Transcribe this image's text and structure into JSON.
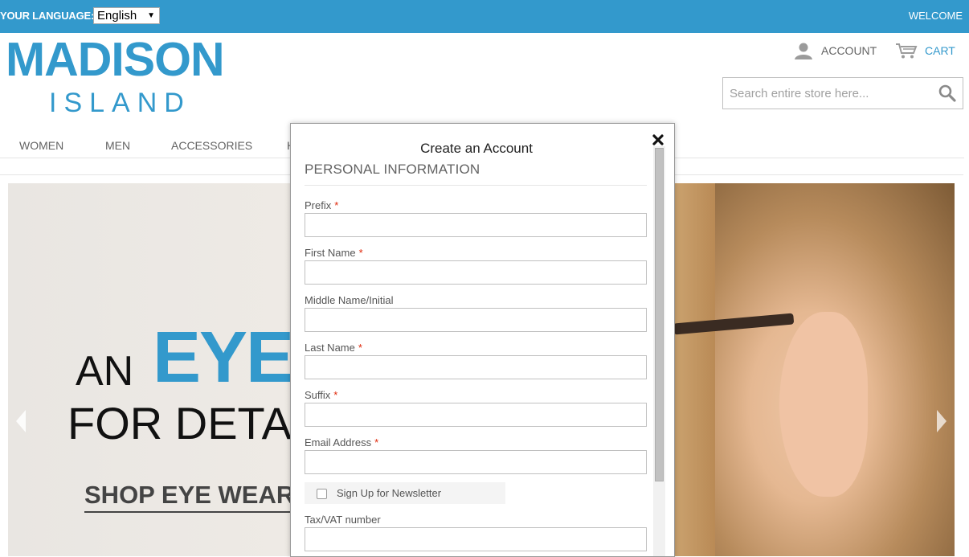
{
  "topbar": {
    "language_label": "YOUR LANGUAGE:",
    "language_selected": "English",
    "welcome": "WELCOME",
    "bg_color": "#3399cc"
  },
  "logo": {
    "main": "MADISON",
    "sub": "ISLAND"
  },
  "header": {
    "account_label": "ACCOUNT",
    "cart_label": "CART",
    "search_placeholder": "Search entire store here..."
  },
  "nav": {
    "items": [
      {
        "label": "WOMEN"
      },
      {
        "label": "MEN"
      },
      {
        "label": "ACCESSORIES"
      },
      {
        "label": "H"
      }
    ]
  },
  "hero": {
    "line1_a": "AN",
    "line1_b": "EYE",
    "line2": "FOR DETAI",
    "cta": "SHOP EYE WEAR"
  },
  "modal": {
    "title": "Create an Account",
    "section": "PERSONAL INFORMATION",
    "fields": [
      {
        "label": "Prefix",
        "required": "*"
      },
      {
        "label": "First Name",
        "required": "*"
      },
      {
        "label": "Middle Name/Initial",
        "required": ""
      },
      {
        "label": "Last Name",
        "required": "*"
      },
      {
        "label": "Suffix",
        "required": "*"
      },
      {
        "label": "Email Address",
        "required": "*"
      }
    ],
    "newsletter_label": "Sign Up for Newsletter",
    "tax_label": "Tax/VAT number"
  },
  "colors": {
    "accent": "#3399cc",
    "required": "#df280a"
  }
}
